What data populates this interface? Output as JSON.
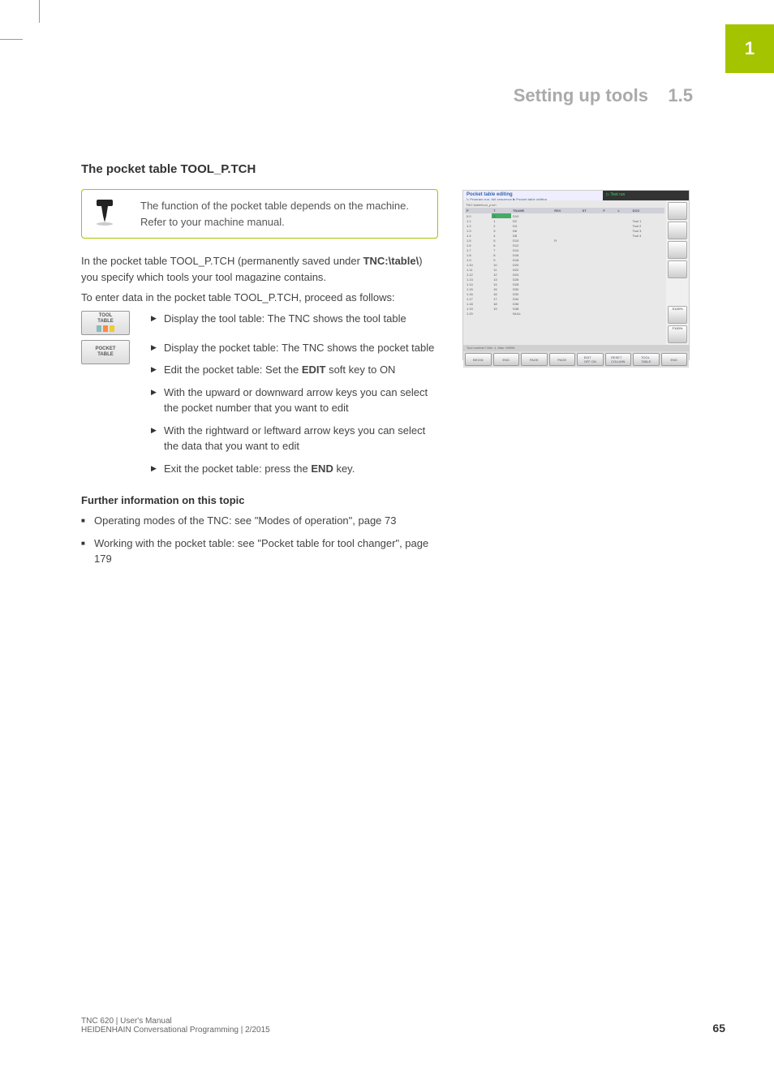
{
  "chapter_tab": "1",
  "header": {
    "title": "Setting up tools",
    "num": "1.5"
  },
  "section_title": "The pocket table TOOL_P.TCH",
  "note": "The function of the pocket table depends on the machine. Refer to your machine manual.",
  "para1_pre": "In the pocket table TOOL_P.TCH (permanently saved under ",
  "para1_bold": "TNC:\\table\\",
  "para1_post": ") you specify which tools your tool magazine contains.",
  "para2": "To enter data in the pocket table TOOL_P.TCH, proceed as follows:",
  "softkey1": "TOOL\nTABLE",
  "softkey2": "POCKET\nTABLE",
  "step1": "Display the tool table: The TNC shows the tool table",
  "step2": "Display the pocket table: The TNC shows the pocket table",
  "step3_pre": "Edit the pocket table: Set the ",
  "step3_bold": "EDIT",
  "step3_post": " soft key to ON",
  "step4": "With the upward or downward arrow keys you can select the pocket number that you want to edit",
  "step5": "With the rightward or leftward arrow keys you can select the data that you want to edit",
  "step6_pre": "Exit the pocket table: press the ",
  "step6_bold": "END",
  "step6_post": " key.",
  "further_title": "Further information on this topic",
  "further1": "Operating modes of the TNC: see \"Modes of operation\", page 73",
  "further2": "Working with the pocket table: see \"Pocket table for tool changer\", page 179",
  "footer": {
    "line1": "TNC 620 | User's Manual",
    "line2": "HEIDENHAIN Conversational Programming | 2/2015",
    "page": "65"
  },
  "screenshot": {
    "title_left": "Pocket table editing",
    "sub_left": "▷ Program run, full sequence ▶ Pocket table editing",
    "title_right": "▷ Test run",
    "path": "TNC:\\table\\tool_p.tch",
    "headers": [
      "P",
      "T",
      "TNAME",
      "RSV",
      "ST",
      "F",
      "L",
      "DOC"
    ],
    "rows": [
      {
        "p": "0.0",
        "t": "5",
        "hl": true,
        "tname": "D10",
        "doc": ""
      },
      {
        "p": "1.1",
        "t": "1",
        "tname": "D2",
        "doc": "Tool 1"
      },
      {
        "p": "1.2",
        "t": "2",
        "tname": "D4",
        "doc": "Tool 2"
      },
      {
        "p": "1.3",
        "t": "3",
        "tname": "D6",
        "doc": "Tool 3"
      },
      {
        "p": "1.4",
        "t": "4",
        "tname": "D8",
        "doc": "Tool 4"
      },
      {
        "p": "1.5",
        "t": "5",
        "tname": "D10",
        "doc": "",
        "rsv": "R"
      },
      {
        "p": "1.6",
        "t": "6",
        "tname": "D12",
        "doc": ""
      },
      {
        "p": "1.7",
        "t": "7",
        "tname": "D14",
        "doc": ""
      },
      {
        "p": "1.8",
        "t": "8",
        "tname": "D16",
        "doc": ""
      },
      {
        "p": "1.9",
        "t": "9",
        "tname": "D18",
        "doc": ""
      },
      {
        "p": "1.10",
        "t": "10",
        "tname": "D20",
        "doc": ""
      },
      {
        "p": "1.11",
        "t": "11",
        "tname": "D22",
        "doc": ""
      },
      {
        "p": "1.12",
        "t": "12",
        "tname": "D24",
        "doc": ""
      },
      {
        "p": "1.13",
        "t": "13",
        "tname": "D26",
        "doc": ""
      },
      {
        "p": "1.14",
        "t": "14",
        "tname": "D28",
        "doc": ""
      },
      {
        "p": "1.15",
        "t": "15",
        "tname": "D30",
        "doc": ""
      },
      {
        "p": "1.16",
        "t": "16",
        "tname": "D32",
        "doc": ""
      },
      {
        "p": "1.17",
        "t": "17",
        "tname": "D34",
        "doc": ""
      },
      {
        "p": "1.18",
        "t": "18",
        "tname": "D36",
        "doc": ""
      },
      {
        "p": "1.19",
        "t": "19",
        "tname": "D38",
        "doc": ""
      },
      {
        "p": "1.20",
        "t": "",
        "tname": "NULL",
        "doc": ""
      }
    ],
    "footer_info": "Tool number?     Min: 1, Max: 99999",
    "keys": [
      "BEGIN",
      "END",
      "PAGE",
      "PAGE",
      "EDIT",
      "RESET",
      "TOOL",
      "END"
    ],
    "key_sub": [
      "",
      "",
      "",
      "",
      "OFF ON",
      "COLUMN",
      "TABLE",
      ""
    ]
  }
}
